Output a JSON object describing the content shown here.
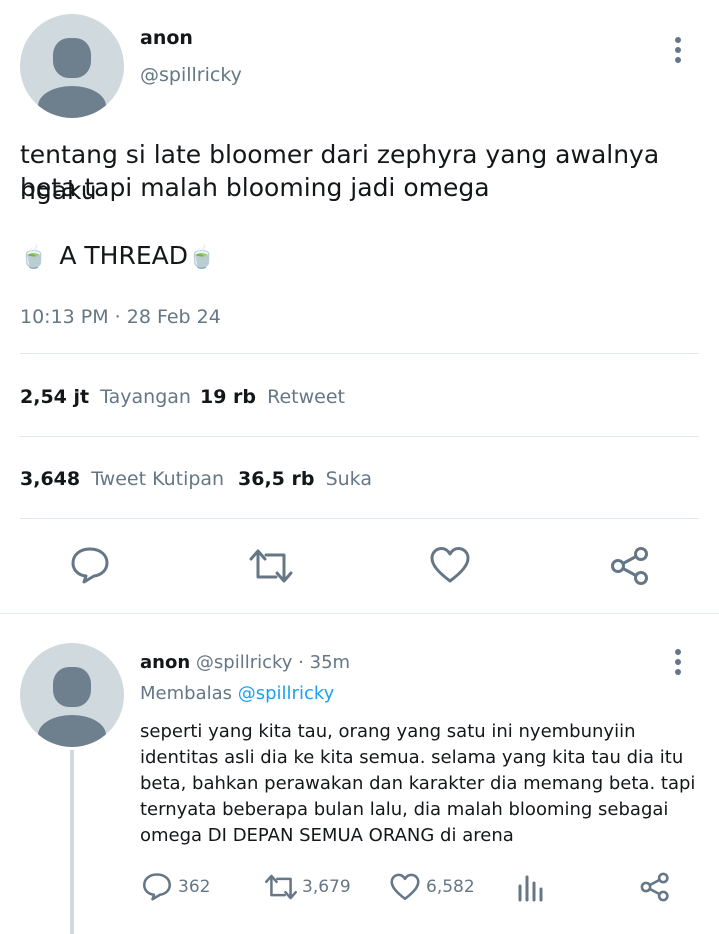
{
  "main_tweet": {
    "author_name": "anon",
    "author_handle": "@spillricky",
    "text_line1": "tentang si late bloomer dari zephyra yang awalnya ngaku",
    "text_line2": "beta tapi malah blooming jadi omega",
    "thread_label": "A THREAD",
    "emoji": "🍵",
    "timestamp": "10:13 PM · 28 Feb 24",
    "stats": {
      "views_count": "2,54 jt",
      "views_label": "Tayangan",
      "retweets_count": "19 rb",
      "retweets_label": "Retweet",
      "quotes_count": "3,648",
      "quotes_label": "Tweet Kutipan",
      "likes_count": "36,5 rb",
      "likes_label": "Suka"
    }
  },
  "reply": {
    "author_name": "anon",
    "author_handle": "@spillricky",
    "time": "· 35m",
    "replying_to_label": "Membalas",
    "replying_to_handle": "@spillricky",
    "lines": [
      "seperti yang kita tau, orang yang satu ini nyembunyiin",
      "identitas asli dia ke kita semua. selama yang kita tau dia itu",
      "beta, bahkan perawakan dan karakter dia memang beta. tapi",
      "ternyata beberapa bulan lalu, dia malah blooming sebagai",
      "omega DI DEPAN SEMUA ORANG di arena"
    ],
    "actions": {
      "replies": "362",
      "retweets": "3,679",
      "likes": "6,582"
    }
  },
  "colors": {
    "text": "#14171a",
    "muted": "#657786",
    "link": "#1da1f2",
    "divider": "#e1e8ed",
    "avatar_bg": "#cfd9de",
    "avatar_fg": "#6e7f8e"
  }
}
